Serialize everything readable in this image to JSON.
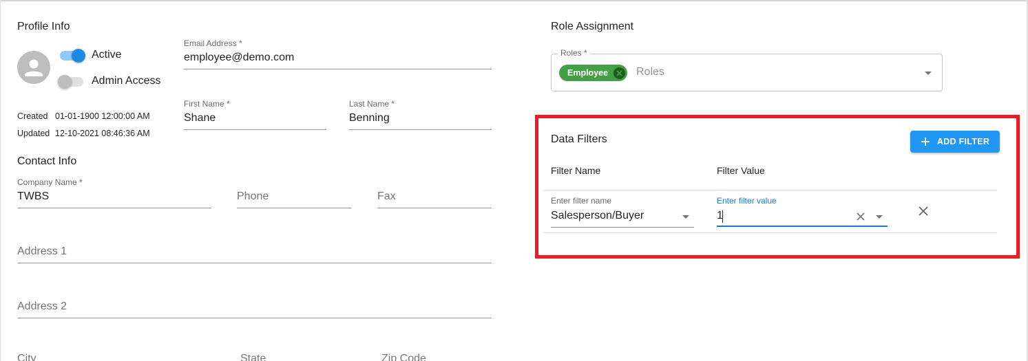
{
  "colors": {
    "primary": "#1976d2",
    "button": "#2196f3",
    "success_chip": "#43a047",
    "highlight": "#ed1c24",
    "switch_on_track": "#90caf9",
    "switch_on_thumb": "#1e88e5",
    "switch_off_track": "#e0e0e0",
    "switch_off_thumb": "#bdbdbd"
  },
  "profile": {
    "title": "Profile Info",
    "avatar_icon": "person-icon",
    "active_label": "Active",
    "active_on": true,
    "admin_label": "Admin Access",
    "admin_on": false,
    "created_label": "Created",
    "created_value": "01-01-1900 12:00:00 AM",
    "updated_label": "Updated",
    "updated_value": "12-10-2021 08:46:36 AM",
    "email": {
      "label": "Email Address *",
      "value": "employee@demo.com"
    },
    "first_name": {
      "label": "First Name *",
      "value": "Shane"
    },
    "last_name": {
      "label": "Last Name *",
      "value": "Benning"
    }
  },
  "contact": {
    "title": "Contact Info",
    "company": {
      "label": "Company Name *",
      "value": "TWBS"
    },
    "phone": {
      "placeholder": "Phone"
    },
    "fax": {
      "placeholder": "Fax"
    },
    "address1": {
      "placeholder": "Address 1"
    },
    "address2": {
      "placeholder": "Address 2"
    },
    "city": {
      "placeholder": "City"
    },
    "state": {
      "placeholder": "State"
    },
    "zip": {
      "placeholder": "Zip Code"
    }
  },
  "roles": {
    "title": "Role Assignment",
    "label": "Roles *",
    "chips": [
      "Employee"
    ],
    "placeholder": "Roles"
  },
  "filters": {
    "title": "Data Filters",
    "add_button": "ADD FILTER",
    "col_name": "Filter Name",
    "col_value": "Filter Value",
    "rows": [
      {
        "name_label": "Enter filter name",
        "name_value": "Salesperson/Buyer",
        "value_label": "Enter filter value",
        "value_value": "1"
      }
    ]
  }
}
